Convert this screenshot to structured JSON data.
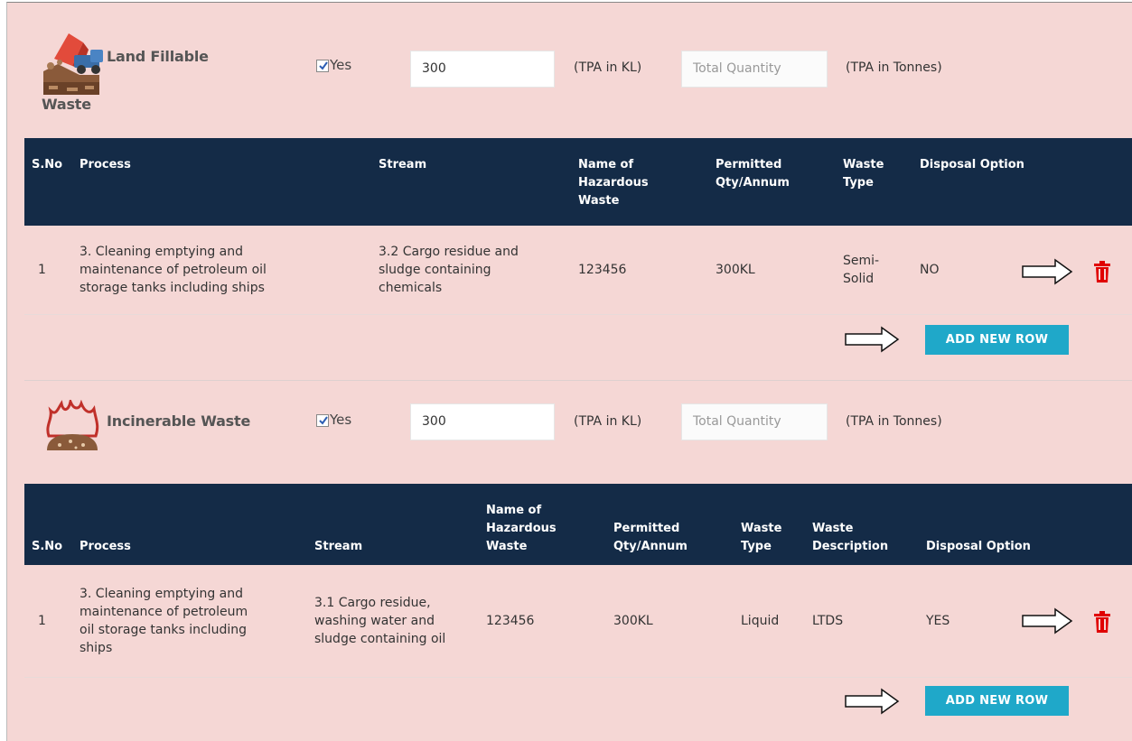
{
  "sections": [
    {
      "title_line1": "Land Fillable",
      "title_line2": "Waste",
      "checkbox_label": "Yes",
      "qty_value": "300",
      "qty_unit": "(TPA in KL)",
      "total_placeholder": "Total Quantity",
      "total_unit": "(TPA in Tonnes)",
      "headers": {
        "sno": "S.No",
        "process": "Process",
        "stream": "Stream",
        "name_l1": "Name of",
        "name_l2": "Hazardous",
        "name_l3": "Waste",
        "qty_l1": "Permitted",
        "qty_l2": "Qty/Annum",
        "type_l1": "Waste",
        "type_l2": "Type",
        "disposal": "Disposal Option"
      },
      "row": {
        "sno": "1",
        "process_l1": "3. Cleaning emptying and",
        "process_l2": "maintenance of petroleum oil",
        "process_l3": "storage tanks including ships",
        "stream_l1": "3.2 Cargo residue and",
        "stream_l2": "sludge containing",
        "stream_l3": "chemicals",
        "name": "123456",
        "qty": "300KL",
        "type_l1": "Semi-",
        "type_l2": "Solid",
        "disposal": "NO"
      },
      "add_button": "ADD NEW ROW"
    },
    {
      "title_line1": "Incinerable Waste",
      "checkbox_label": "Yes",
      "qty_value": "300",
      "qty_unit": "(TPA in KL)",
      "total_placeholder": "Total Quantity",
      "total_unit": "(TPA in Tonnes)",
      "headers": {
        "sno": "S.No",
        "process": "Process",
        "stream": "Stream",
        "name_l1": "Name of",
        "name_l2": "Hazardous",
        "name_l3": "Waste",
        "qty_l1": "Permitted",
        "qty_l2": "Qty/Annum",
        "type_l1": "Waste",
        "type_l2": "Type",
        "desc_l1": "Waste",
        "desc_l2": "Description",
        "disposal": "Disposal Option"
      },
      "row": {
        "sno": "1",
        "process_l1": "3. Cleaning emptying and",
        "process_l2": "maintenance of petroleum",
        "process_l3": "oil storage tanks including",
        "process_l4": "ships",
        "stream_l1": "3.1 Cargo residue,",
        "stream_l2": "washing water and",
        "stream_l3": "sludge containing oil",
        "name": "123456",
        "qty": "300KL",
        "type": "Liquid",
        "desc": "LTDS",
        "disposal": "YES"
      },
      "add_button": "ADD NEW ROW"
    }
  ],
  "colors": {
    "background": "#f5d7d5",
    "header": "#142b47",
    "button": "#1fa8c9",
    "trash": "#e00000"
  },
  "icons": [
    "dump-truck-landfill-icon",
    "fire-incinerator-icon",
    "right-arrow-annotation-icon",
    "trash-icon",
    "checkbox-checked-icon"
  ]
}
